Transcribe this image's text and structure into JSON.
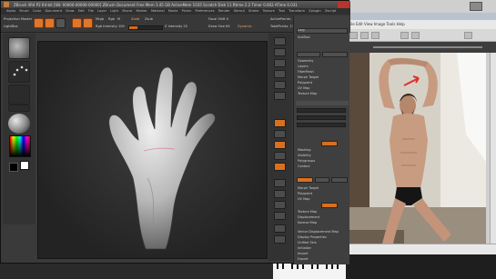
{
  "zbrush": {
    "title": "ZBrush 4R4 P2 64-bit [SN: 00000-00000-00000] ZBrush Document Free Mem 3.45 GB ActiveMem 1035 Scratch Disk 11 Rtime 2.2 Timer 0.002 ATime 0.031",
    "menu": [
      "Alpha",
      "Brush",
      "Color",
      "Document",
      "Draw",
      "Edit",
      "File",
      "Layer",
      "Light",
      "Macro",
      "Marker",
      "Material",
      "Movie",
      "Picker",
      "Preferences",
      "Render",
      "Stencil",
      "Stroke",
      "Texture",
      "Tool",
      "Transform",
      "Zplugin",
      "Zscript"
    ],
    "topbar": {
      "projection_label": "Projection Master",
      "lightbox_label": "LightBox",
      "edit_label": "Edit",
      "draw_label": "Draw",
      "move_label": "Move",
      "scale_label": "Scale",
      "rotate_label": "Rotate",
      "mrgb_label": "Mrgb",
      "rgb_label": "Rgb",
      "m_label": "M",
      "zadd_label": "Zadd",
      "zsub_label": "Zsub",
      "rgb_intensity_label": "Rgb Intensity 100",
      "z_intensity_label": "Z Intensity 25",
      "focal_shift_label": "Focal Shift 0",
      "draw_size_label": "Draw Size 64",
      "dynamic_label": "Dynamic",
      "active_points_label": "ActivePoints: 11,173",
      "total_points_label": "TotalPoints: 135,081",
      "rgb_intensity": 1.0,
      "z_intensity": 0.25,
      "draw_size": 0.3
    },
    "tray": {
      "items": [
        "Lazy",
        "SubTool",
        "Geometry",
        "Layers",
        "FiberMesh",
        "Morph Target",
        "Polypaint",
        "UV Map",
        "Texture Map",
        "Displacement Map",
        "Normal Map",
        "Vector Displacement",
        "Unified Skin",
        "Initialize",
        "Import",
        "Export"
      ],
      "lower_items": [
        "Masking",
        "Visibility",
        "Polygroups",
        "Contact",
        "Morph Target",
        "Polypaint",
        "UV Map",
        "Texture Map",
        "Displacement",
        "Normal Map",
        "Vector Displacement Map",
        "Display Properties",
        "Unified Skin",
        "Initialize",
        "Import",
        "Export"
      ]
    }
  },
  "photo_viewer": {
    "menu_text": "File Edit View Image Tools Help",
    "status_text": ""
  },
  "colors": {
    "zbrush_orange": "#e0762b",
    "zbrush_panel": "#3a3a3a",
    "canvas_dark": "#232323",
    "model_gray": "#b8b8b8"
  }
}
